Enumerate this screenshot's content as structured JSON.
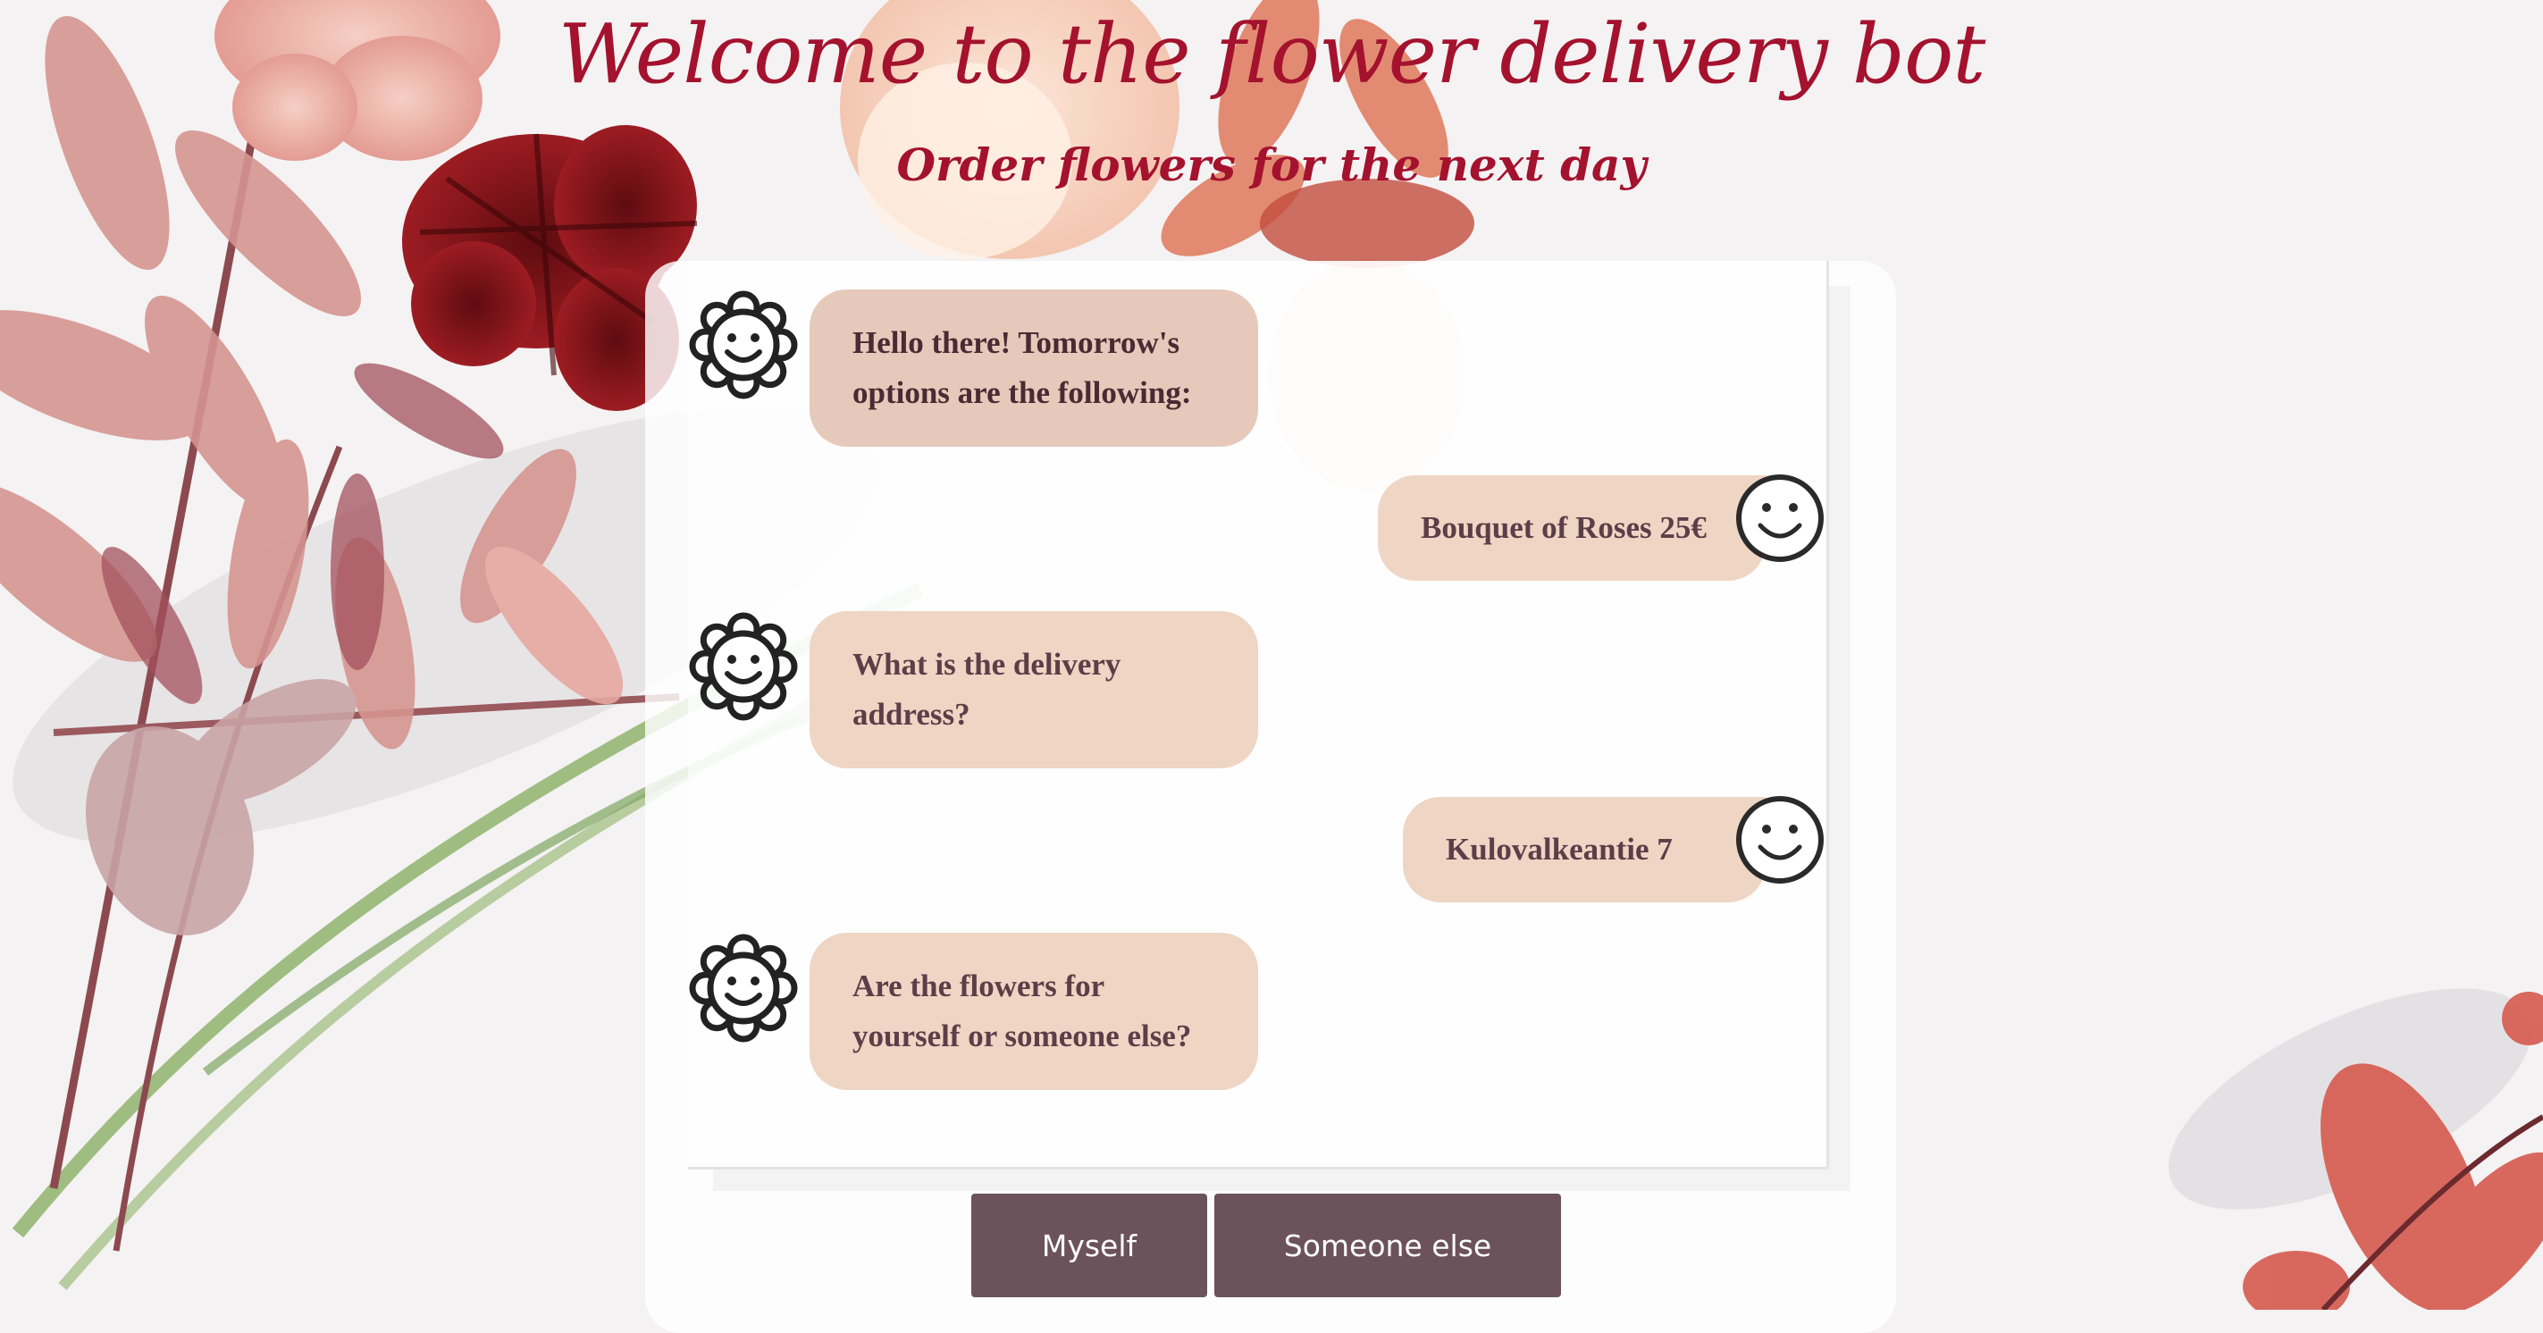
{
  "header": {
    "title": "Welcome to the flower delivery bot",
    "subtitle": "Order flowers for the next day"
  },
  "messages": [
    {
      "sender": "bot",
      "text": "Hello there! Tomorrow's options are the following:"
    },
    {
      "sender": "user",
      "text": "Bouquet of Roses 25€"
    },
    {
      "sender": "bot",
      "text": "What is the delivery address?"
    },
    {
      "sender": "user",
      "text": "Kulovalkeantie 7"
    },
    {
      "sender": "bot",
      "text": "Are the flowers for yourself or someone else?"
    }
  ],
  "quick_replies": [
    "Myself",
    "Someone else"
  ],
  "colors": {
    "title": "#a4122e",
    "bubble": "#eed3c2",
    "bubble_text": "#5b3f48",
    "button": "#6b525b",
    "button_text": "#ffffff"
  },
  "icons": {
    "bot_avatar": "flower-smiley-icon",
    "user_avatar": "smiley-face-icon"
  }
}
